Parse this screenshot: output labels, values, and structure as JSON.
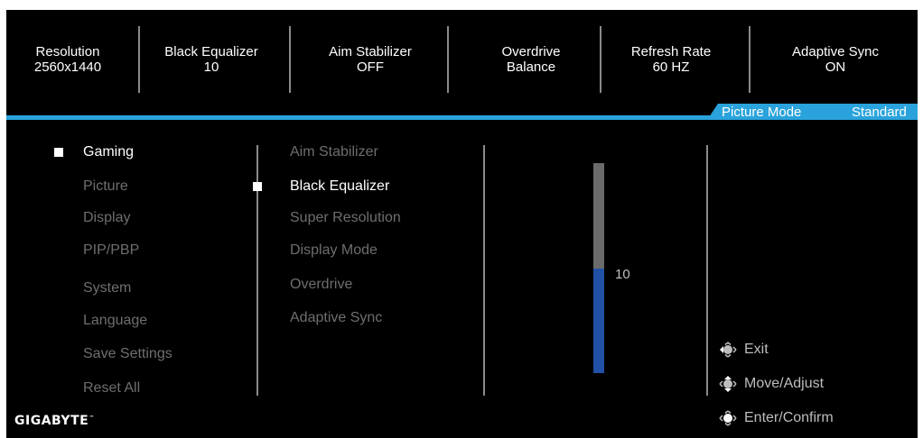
{
  "status_bar": [
    {
      "label": "Resolution",
      "value": "2560x1440"
    },
    {
      "label": "Black Equalizer",
      "value": "10"
    },
    {
      "label": "Aim Stabilizer",
      "value": "OFF"
    },
    {
      "label": "Overdrive",
      "value": "Balance"
    },
    {
      "label": "Refresh Rate",
      "value": "60 HZ"
    },
    {
      "label": "Adaptive Sync",
      "value": "ON"
    }
  ],
  "picture_mode": {
    "label": "Picture Mode",
    "value": "Standard"
  },
  "main_menu": {
    "items": [
      "Gaming",
      "Picture",
      "Display",
      "PIP/PBP",
      "System",
      "Language",
      "Save Settings",
      "Reset All"
    ],
    "selected": "Gaming"
  },
  "sub_menu": {
    "items": [
      "Aim Stabilizer",
      "Black Equalizer",
      "Super Resolution",
      "Display Mode",
      "Overdrive",
      "Adaptive Sync"
    ],
    "selected": "Black Equalizer"
  },
  "slider": {
    "value": "10",
    "fill_fraction": 0.5
  },
  "hints": {
    "exit": "Exit",
    "move": "Move/Adjust",
    "enter": "Enter/Confirm"
  },
  "brand": {
    "logo": "GIGABYTE",
    "tm": "™"
  },
  "colors": {
    "accent": "#2aa3dc",
    "slider_fill": "#2051a5",
    "background": "#000000"
  }
}
